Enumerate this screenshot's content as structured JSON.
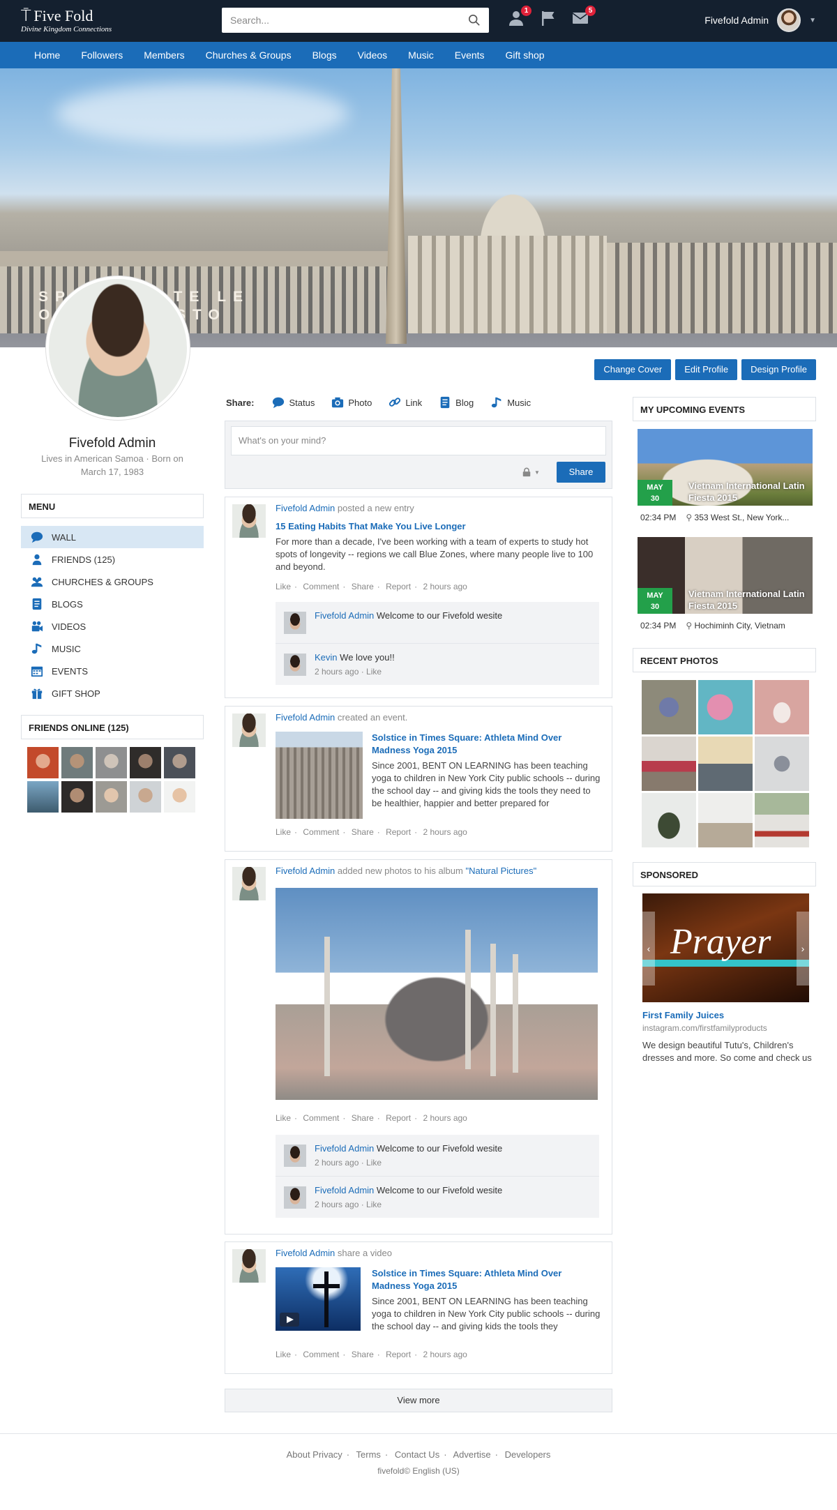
{
  "brand": {
    "name": "Five Fold",
    "tagline": "Divine Kingdom Connections"
  },
  "search": {
    "placeholder": "Search..."
  },
  "top_icons": [
    {
      "icon": "friend-request-icon",
      "badge": "1"
    },
    {
      "icon": "flag-icon",
      "badge": ""
    },
    {
      "icon": "mail-icon",
      "badge": "5"
    }
  ],
  "user": {
    "name": "Fivefold Admin"
  },
  "nav": [
    "Home",
    "Followers",
    "Members",
    "Churches & Groups",
    "Blogs",
    "Videos",
    "Music",
    "Events",
    "Gift shop"
  ],
  "cover": {
    "banner_text_1": "SPALANCATE LE",
    "banner_text_2": "ORE A CRISTO"
  },
  "cover_buttons": [
    "Change Cover",
    "Edit Profile",
    "Design Profile"
  ],
  "profile": {
    "name": "Fivefold Admin",
    "meta": "Lives in American Samoa · Born on March 17, 1983"
  },
  "menu": {
    "title": "MENU",
    "items": [
      {
        "label": "WALL",
        "icon": "chat-bubble-icon",
        "active": true
      },
      {
        "label": "FRIENDS (125)",
        "icon": "user-icon",
        "active": false
      },
      {
        "label": "CHURCHES & GROUPS",
        "icon": "group-icon",
        "active": false
      },
      {
        "label": "BLOGS",
        "icon": "blog-icon",
        "active": false
      },
      {
        "label": "VIDEOS",
        "icon": "video-icon",
        "active": false
      },
      {
        "label": "MUSIC",
        "icon": "music-icon",
        "active": false
      },
      {
        "label": "EVENTS",
        "icon": "calendar-icon",
        "active": false
      },
      {
        "label": "GIFT SHOP",
        "icon": "gift-icon",
        "active": false
      }
    ]
  },
  "friends_online": {
    "title": "FRIENDS ONLINE (125)"
  },
  "share": {
    "label": "Share:",
    "items": [
      "Status",
      "Photo",
      "Link",
      "Blog",
      "Music"
    ],
    "placeholder": "What's on your mind?",
    "button": "Share"
  },
  "actions": {
    "like": "Like",
    "comment": "Comment",
    "share": "Share",
    "report": "Report",
    "time": "2 hours ago"
  },
  "posts": [
    {
      "author": "Fivefold Admin",
      "action": "posted a new entry",
      "title": "15 Eating Habits That Make You Live Longer",
      "body": "For more than a decade, I've been working with a team of experts to study hot spots of longevity -- regions we call Blue Zones, where many people live to 100 and beyond.",
      "comments": [
        {
          "author": "Fivefold Admin",
          "text": "Welcome to our Fivefold wesite",
          "time": ""
        },
        {
          "author": "Kevin",
          "text": "We love you!!",
          "time": "2 hours ago · Like"
        }
      ]
    },
    {
      "author": "Fivefold Admin",
      "action": "created an event.",
      "title": "Solstice in Times Square: Athleta Mind Over Madness Yoga 2015",
      "body": "Since 2001, BENT ON LEARNING has been teaching yoga to children in New York City public schools -- during the school day -- and giving kids the tools they need to be healthier, happier and better prepared for"
    },
    {
      "author": "Fivefold Admin",
      "action": "added new photos to his album",
      "album": "\"Natural Pictures\"",
      "comments": [
        {
          "author": "Fivefold Admin",
          "text": "Welcome to our Fivefold wesite",
          "time": "2 hours ago · Like"
        },
        {
          "author": "Fivefold Admin",
          "text": "Welcome to our Fivefold wesite",
          "time": "2 hours ago · Like"
        }
      ]
    },
    {
      "author": "Fivefold Admin",
      "action": "share a video",
      "title": "Solstice in Times Square: Athleta Mind Over Madness Yoga 2015",
      "body": "Since 2001, BENT ON LEARNING has been teaching yoga to children in New York City public schools -- during the school day -- and giving kids the tools they"
    }
  ],
  "view_more": "View more",
  "events": {
    "title": "MY UPCOMING EVENTS",
    "items": [
      {
        "month": "MAY",
        "day": "30",
        "name": "Vietnam International Latin Fiesta 2015",
        "time": "02:34 PM",
        "location": "353 West St., New York..."
      },
      {
        "month": "MAY",
        "day": "30",
        "name": "Vietnam International Latin Fiesta 2015",
        "time": "02:34 PM",
        "location": "Hochiminh City, Vietnam"
      }
    ]
  },
  "recent_photos": {
    "title": "RECENT PHOTOS"
  },
  "sponsored": {
    "title": "SPONSORED",
    "image_text": "Prayer",
    "name": "First Family Juices",
    "url": "instagram.com/firstfamilyproducts",
    "desc": "We design beautiful Tutu's, Children's dresses and more. So come and check us"
  },
  "footer": {
    "links": [
      "About Privacy",
      "Terms",
      "Contact Us",
      "Advertise",
      "Developers"
    ],
    "copy": "fivefold© English (US)"
  },
  "colors": {
    "topbar": "#14202f",
    "nav": "#1b6cb8",
    "accent": "#1b6cb8",
    "event_badge": "#23a04a",
    "badge": "#e0223a"
  }
}
